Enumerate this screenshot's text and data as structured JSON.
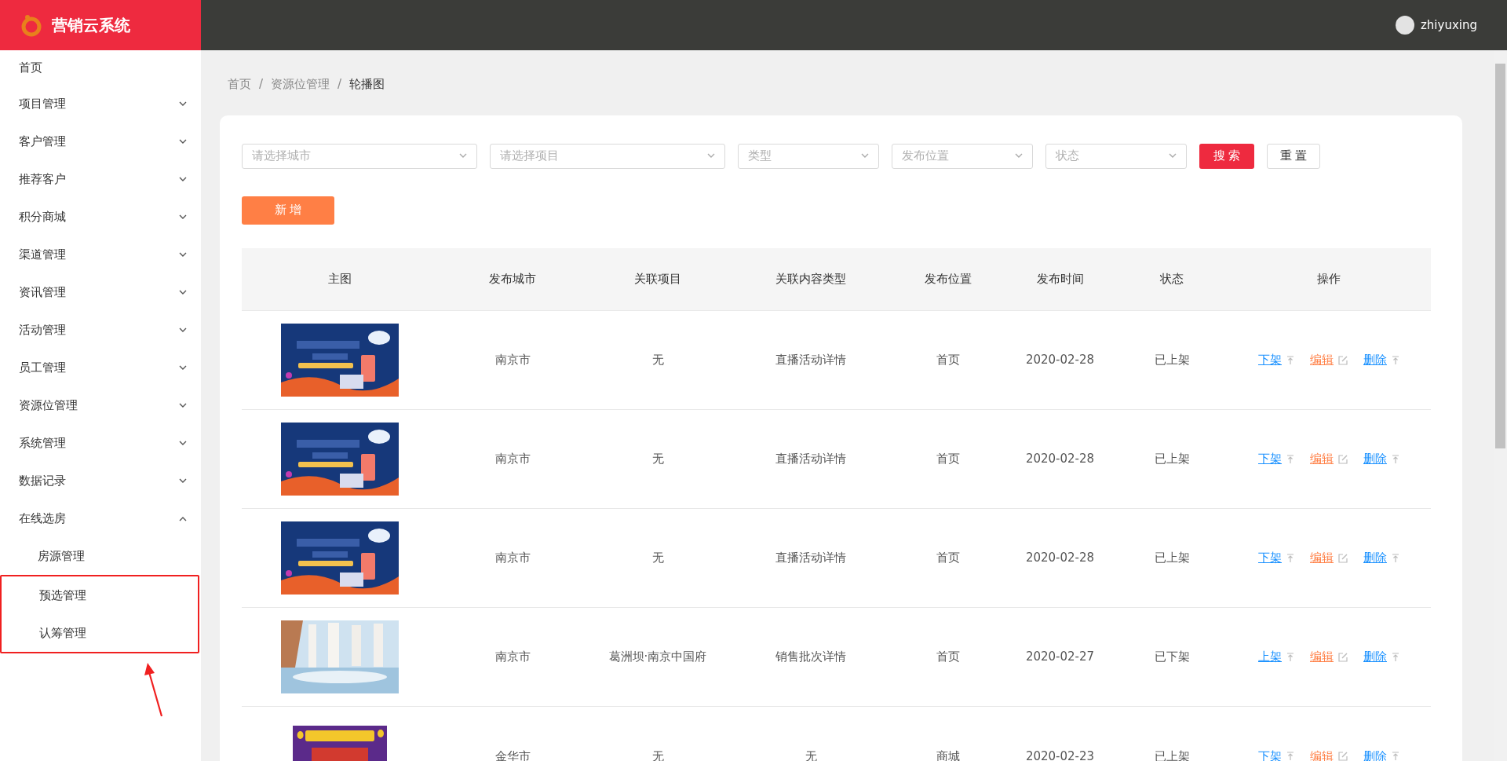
{
  "header": {
    "logo_text": "营销云系统",
    "user": "zhiyuxing"
  },
  "sidebar": {
    "items": [
      {
        "label": "首页"
      },
      {
        "label": "项目管理",
        "expanded": false
      },
      {
        "label": "客户管理",
        "expanded": false
      },
      {
        "label": "推荐客户",
        "expanded": false
      },
      {
        "label": "积分商城",
        "expanded": false
      },
      {
        "label": "渠道管理",
        "expanded": false
      },
      {
        "label": "资讯管理",
        "expanded": false
      },
      {
        "label": "活动管理",
        "expanded": false
      },
      {
        "label": "员工管理",
        "expanded": false
      },
      {
        "label": "资源位管理",
        "expanded": false
      },
      {
        "label": "系统管理",
        "expanded": false
      },
      {
        "label": "数据记录",
        "expanded": false
      },
      {
        "label": "在线选房",
        "expanded": true,
        "children": [
          {
            "label": "房源管理",
            "highlighted": false
          },
          {
            "label": "预选管理",
            "highlighted": true
          },
          {
            "label": "认筹管理",
            "highlighted": true
          }
        ]
      }
    ]
  },
  "breadcrumb": [
    "首页",
    "资源位管理",
    "轮播图"
  ],
  "breadcrumb_separator": "/",
  "filters": [
    {
      "placeholder": "请选择城市"
    },
    {
      "placeholder": "请选择项目"
    },
    {
      "placeholder": "类型"
    },
    {
      "placeholder": "发布位置"
    },
    {
      "placeholder": "状态"
    }
  ],
  "search_button": "搜 索",
  "reset_button": "重 置",
  "add_button": "新 增",
  "table": {
    "columns": [
      "主图",
      "发布城市",
      "关联项目",
      "关联内容类型",
      "发布位置",
      "发布时间",
      "状态",
      "操作"
    ],
    "rows": [
      {
        "image": {
          "kind": "banner"
        },
        "city": "南京市",
        "project": "无",
        "content_type": "直播活动详情",
        "position": "首页",
        "time": "2020-02-28",
        "status": "已上架",
        "actions": [
          {
            "kind": "toggle",
            "label": "下架"
          },
          {
            "kind": "edit",
            "label": "编辑"
          },
          {
            "kind": "delete",
            "label": "删除"
          }
        ]
      },
      {
        "image": {
          "kind": "banner"
        },
        "city": "南京市",
        "project": "无",
        "content_type": "直播活动详情",
        "position": "首页",
        "time": "2020-02-28",
        "status": "已上架",
        "actions": [
          {
            "kind": "toggle",
            "label": "下架"
          },
          {
            "kind": "edit",
            "label": "编辑"
          },
          {
            "kind": "delete",
            "label": "删除"
          }
        ]
      },
      {
        "image": {
          "kind": "banner"
        },
        "city": "南京市",
        "project": "无",
        "content_type": "直播活动详情",
        "position": "首页",
        "time": "2020-02-28",
        "status": "已上架",
        "actions": [
          {
            "kind": "toggle",
            "label": "下架"
          },
          {
            "kind": "edit",
            "label": "编辑"
          },
          {
            "kind": "delete",
            "label": "删除"
          }
        ]
      },
      {
        "image": {
          "kind": "waterfall"
        },
        "city": "南京市",
        "project": "葛洲坝·南京中国府",
        "content_type": "销售批次详情",
        "position": "首页",
        "time": "2020-02-27",
        "status": "已下架",
        "actions": [
          {
            "kind": "toggle",
            "label": "上架"
          },
          {
            "kind": "edit",
            "label": "编辑"
          },
          {
            "kind": "delete",
            "label": "删除"
          }
        ]
      },
      {
        "image": {
          "kind": "poster"
        },
        "city": "金华市",
        "project": "无",
        "content_type": "无",
        "position": "商城",
        "time": "2020-02-23",
        "status": "已上架",
        "actions": [
          {
            "kind": "toggle",
            "label": "下架"
          },
          {
            "kind": "edit",
            "label": "编辑"
          },
          {
            "kind": "delete",
            "label": "删除"
          }
        ]
      }
    ]
  }
}
